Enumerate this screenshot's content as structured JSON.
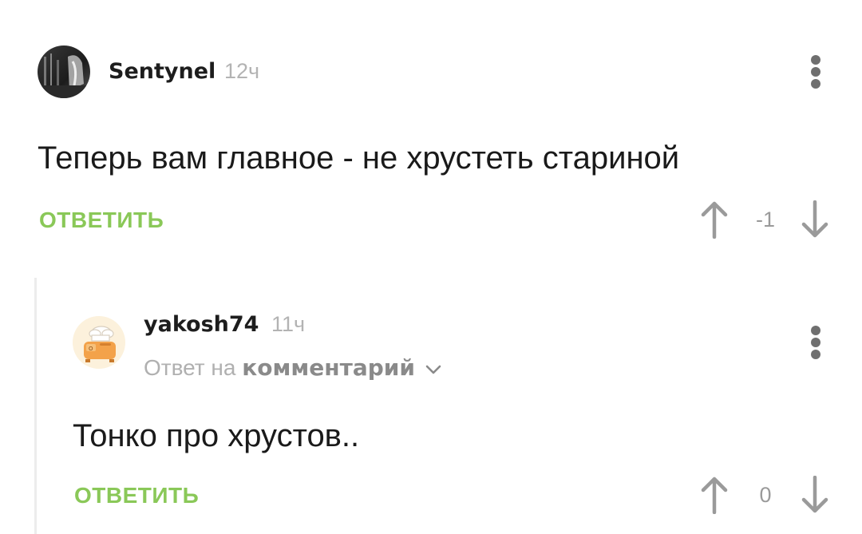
{
  "comments": [
    {
      "username": "Sentynel",
      "time": "12ч",
      "text": "Теперь вам главное - не хрустеть стариной",
      "reply_label": "ОТВЕТИТЬ",
      "score": "-1",
      "avatar_icon": "user-photo-avatar-icon"
    },
    {
      "username": "yakosh74",
      "time": "11ч",
      "reply_prefix": "Ответ на",
      "reply_target": "комментарий",
      "text": "Тонко про хрустов..",
      "reply_label": "ОТВЕТИТЬ",
      "score": "0",
      "avatar_icon": "chef-toaster-avatar-icon"
    }
  ],
  "colors": {
    "accent_green": "#8ac858",
    "muted_gray": "#b3b3b3",
    "icon_gray": "#6f6f6f",
    "arrow_gray": "#9a9a9a"
  }
}
